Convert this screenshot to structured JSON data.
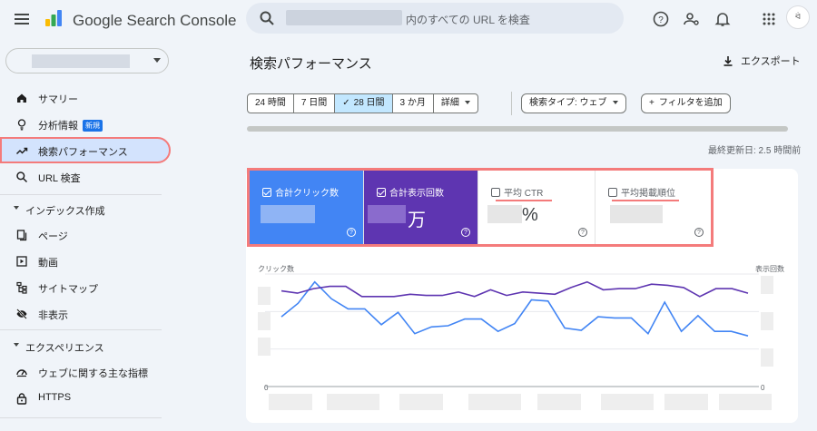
{
  "app": {
    "title": "Google Search Console"
  },
  "search": {
    "placeholder": "内のすべての URL を検査"
  },
  "sidebar": {
    "items": [
      {
        "label": "サマリー",
        "icon": "home-icon"
      },
      {
        "label": "分析情報",
        "icon": "lightbulb-icon",
        "badge": "新規"
      },
      {
        "label": "検索パフォーマンス",
        "icon": "trending-up-icon",
        "active": true
      },
      {
        "label": "URL 検査",
        "icon": "search-icon"
      }
    ],
    "sections": [
      {
        "label": "インデックス作成",
        "items": [
          {
            "label": "ページ",
            "icon": "pages-icon"
          },
          {
            "label": "動画",
            "icon": "video-icon"
          },
          {
            "label": "サイトマップ",
            "icon": "sitemap-icon"
          },
          {
            "label": "非表示",
            "icon": "eye-off-icon"
          }
        ]
      },
      {
        "label": "エクスペリエンス",
        "items": [
          {
            "label": "ウェブに関する主な指標",
            "icon": "speedometer-icon"
          },
          {
            "label": "HTTPS",
            "icon": "lock-icon"
          }
        ]
      }
    ]
  },
  "main": {
    "title": "検索パフォーマンス",
    "export_label": "エクスポート",
    "date_ranges": [
      "24 時間",
      "7 日間",
      "28 日間",
      "3 か月",
      "詳細"
    ],
    "selected_range": "28 日間",
    "search_type": "検索タイプ: ウェブ",
    "add_filter": "フィルタを追加",
    "last_updated": "最終更新日: 2.5 時間前"
  },
  "metrics": [
    {
      "label": "合計クリック数",
      "unit": "",
      "checked": true,
      "color": "#4285f4"
    },
    {
      "label": "合計表示回数",
      "unit": "万",
      "checked": true,
      "color": "#5e35b1"
    },
    {
      "label": "平均 CTR",
      "unit": "%",
      "checked": false,
      "color": "#ffffff"
    },
    {
      "label": "平均掲載順位",
      "unit": "",
      "checked": false,
      "color": "#ffffff"
    }
  ],
  "chart_data": {
    "type": "line",
    "ylabel_left": "クリック数",
    "ylabel_right": "表示回数",
    "ymin_label": "0",
    "series": [
      {
        "axis": "left",
        "color": "#4285f4",
        "values": [
          0.62,
          0.74,
          0.93,
          0.78,
          0.69,
          0.69,
          0.55,
          0.66,
          0.47,
          0.53,
          0.54,
          0.6,
          0.6,
          0.49,
          0.56,
          0.77,
          0.76,
          0.52,
          0.5,
          0.62,
          0.61,
          0.61,
          0.47,
          0.75,
          0.49,
          0.63,
          0.49,
          0.49,
          0.45
        ]
      },
      {
        "axis": "right",
        "color": "#5e35b1",
        "values": [
          0.85,
          0.83,
          0.87,
          0.89,
          0.89,
          0.8,
          0.8,
          0.8,
          0.82,
          0.81,
          0.81,
          0.84,
          0.8,
          0.86,
          0.81,
          0.84,
          0.83,
          0.82,
          0.88,
          0.93,
          0.86,
          0.87,
          0.87,
          0.91,
          0.9,
          0.88,
          0.8,
          0.87,
          0.87,
          0.83
        ]
      }
    ],
    "grid": true
  }
}
